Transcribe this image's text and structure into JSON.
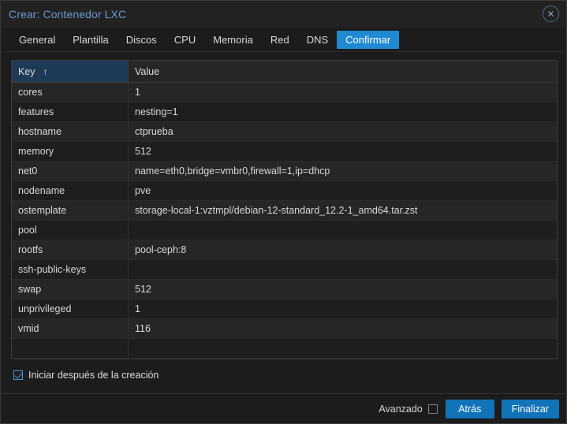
{
  "window": {
    "title": "Crear: Contenedor LXC",
    "close_icon": "close-circle-icon"
  },
  "tabs": [
    {
      "label": "General",
      "active": false
    },
    {
      "label": "Plantilla",
      "active": false
    },
    {
      "label": "Discos",
      "active": false
    },
    {
      "label": "CPU",
      "active": false
    },
    {
      "label": "Memoria",
      "active": false
    },
    {
      "label": "Red",
      "active": false
    },
    {
      "label": "DNS",
      "active": false
    },
    {
      "label": "Confirmar",
      "active": true
    }
  ],
  "grid": {
    "columns": [
      {
        "label": "Key",
        "sorted": true,
        "sort_indicator": "↑"
      },
      {
        "label": "Value",
        "sorted": false,
        "sort_indicator": ""
      }
    ],
    "rows": [
      {
        "key": "cores",
        "value": "1"
      },
      {
        "key": "features",
        "value": "nesting=1"
      },
      {
        "key": "hostname",
        "value": "ctprueba"
      },
      {
        "key": "memory",
        "value": "512"
      },
      {
        "key": "net0",
        "value": "name=eth0,bridge=vmbr0,firewall=1,ip=dhcp"
      },
      {
        "key": "nodename",
        "value": "pve"
      },
      {
        "key": "ostemplate",
        "value": "storage-local-1:vztmpl/debian-12-standard_12.2-1_amd64.tar.zst"
      },
      {
        "key": "pool",
        "value": ""
      },
      {
        "key": "rootfs",
        "value": "pool-ceph:8"
      },
      {
        "key": "ssh-public-keys",
        "value": ""
      },
      {
        "key": "swap",
        "value": "512"
      },
      {
        "key": "unprivileged",
        "value": "1"
      },
      {
        "key": "vmid",
        "value": "116"
      },
      {
        "key": "",
        "value": ""
      }
    ]
  },
  "start_option": {
    "label": "Iniciar después de la creación",
    "checked": true
  },
  "footer": {
    "advanced_label": "Avanzado",
    "advanced_checked": false,
    "back_label": "Atrás",
    "finish_label": "Finalizar"
  },
  "colors": {
    "accent": "#1f8ad2",
    "button": "#1273b8",
    "title_text": "#6a9ad4",
    "sorted_header": "#1d3a57",
    "window_bg": "#1c1c1c",
    "row_odd": "#262626",
    "row_even": "#1e1e1e"
  }
}
